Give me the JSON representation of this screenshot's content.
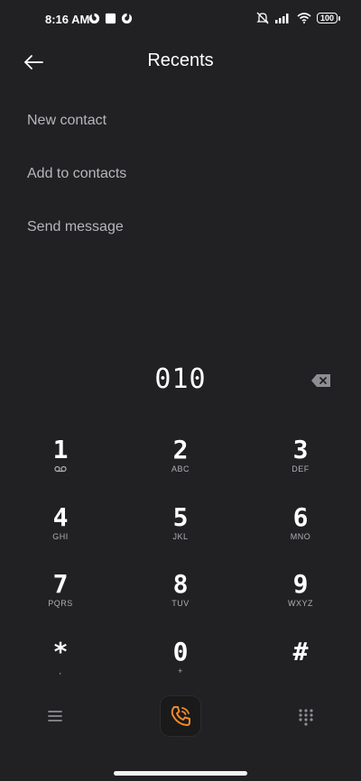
{
  "status_bar": {
    "time": "8:16 AM",
    "battery": "100",
    "left_icons": [
      "vpn-key-icon",
      "square-icon",
      "vpn-key-icon"
    ],
    "right_icons": [
      "mute-vibrate-icon",
      "signal-icon",
      "wifi-icon",
      "battery-icon"
    ]
  },
  "header": {
    "title": "Recents",
    "back_icon": "arrow-left-icon"
  },
  "menu": {
    "items": [
      "New contact",
      "Add to contacts",
      "Send message"
    ]
  },
  "dialer": {
    "number": "010",
    "keys": [
      {
        "digit": "1",
        "letters": ""
      },
      {
        "digit": "2",
        "letters": "ABC"
      },
      {
        "digit": "3",
        "letters": "DEF"
      },
      {
        "digit": "4",
        "letters": "GHI"
      },
      {
        "digit": "5",
        "letters": "JKL"
      },
      {
        "digit": "6",
        "letters": "MNO"
      },
      {
        "digit": "7",
        "letters": "PQRS"
      },
      {
        "digit": "8",
        "letters": "TUV"
      },
      {
        "digit": "9",
        "letters": "WXYZ"
      },
      {
        "digit": "*",
        "letters": ","
      },
      {
        "digit": "0",
        "letters": "+"
      },
      {
        "digit": "#",
        "letters": ""
      }
    ]
  },
  "colors": {
    "background": "#212124",
    "text": "#ffffff",
    "secondary_text": "#b7b7bb",
    "accent": "#f08a2c"
  }
}
